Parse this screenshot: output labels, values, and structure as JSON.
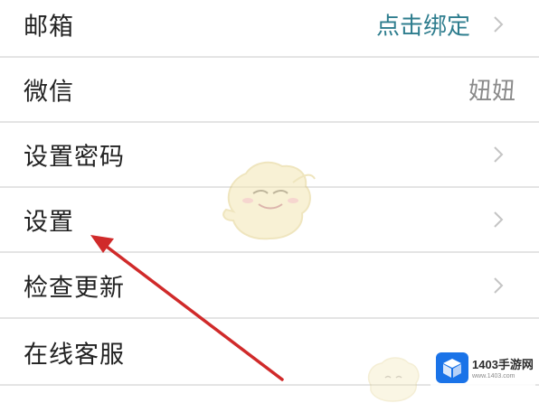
{
  "colors": {
    "background": "#ffffff",
    "divider": "#e4e4e4",
    "label_text": "#222222",
    "link_value": "#2e7d8e",
    "plain_value": "#8a8a8a",
    "chevron": "#c4c4c4",
    "annotation_arrow": "#d02a2a",
    "brand_logo": "#1a73e8"
  },
  "settings_list": {
    "rows": [
      {
        "label": "邮箱",
        "value": "点击绑定",
        "has_chevron": true,
        "chevron_icon": "chevron-right-icon"
      },
      {
        "label": "微信",
        "value": "妞妞",
        "has_chevron": false
      },
      {
        "label": "设置密码",
        "has_chevron": true,
        "chevron_icon": "chevron-right-icon"
      },
      {
        "label": "设置",
        "has_chevron": true,
        "chevron_icon": "chevron-right-icon"
      },
      {
        "label": "检查更新",
        "has_chevron": true,
        "chevron_icon": "chevron-right-icon"
      },
      {
        "label": "在线客服",
        "has_chevron": false
      }
    ]
  },
  "annotation": {
    "icon": "red-arrow-pointing-to-settings",
    "target": "设置"
  },
  "watermark": {
    "mascot_icon": "mascot-watermark-icon",
    "brand_icon": "cube-logo-icon",
    "brand_name": "1403手游网",
    "brand_url": "www.1403.com"
  }
}
